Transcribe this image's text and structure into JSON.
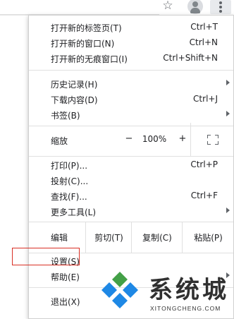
{
  "menu": {
    "group1": [
      {
        "label": "打开新的标签页(T)",
        "shortcut": "Ctrl+T"
      },
      {
        "label": "打开新的窗口(N)",
        "shortcut": "Ctrl+N"
      },
      {
        "label": "打开新的无痕窗口(I)",
        "shortcut": "Ctrl+Shift+N"
      }
    ],
    "group2": [
      {
        "label": "历史记录(H)",
        "shortcut": ""
      },
      {
        "label": "下载内容(D)",
        "shortcut": "Ctrl+J"
      },
      {
        "label": "书签(B)",
        "shortcut": ""
      }
    ],
    "zoom": {
      "label": "缩放",
      "minus": "−",
      "value": "100%",
      "plus": "+"
    },
    "group3": [
      {
        "label": "打印(P)...",
        "shortcut": "Ctrl+P"
      },
      {
        "label": "投射(C)...",
        "shortcut": ""
      },
      {
        "label": "查找(F)...",
        "shortcut": "Ctrl+F"
      },
      {
        "label": "更多工具(L)",
        "shortcut": ""
      }
    ],
    "edit": {
      "label": "编辑",
      "cut": "剪切(T)",
      "copy": "复制(C)",
      "paste": "粘贴(P)"
    },
    "settings": "设置(S)",
    "help": "帮助(E)",
    "exit": "退出(X)"
  },
  "watermark": {
    "title": "系统城",
    "subtitle": "XITONGCHENG.COM"
  },
  "colors": {
    "highlight": "#d93025",
    "logo_blue": "#1e88e5",
    "logo_green": "#43a047"
  },
  "icons": {
    "bookmark": "star-icon",
    "profile": "avatar-icon",
    "menu": "kebab-menu-icon",
    "fullscreen": "fullscreen-icon",
    "submenu": "chevron-right-icon"
  }
}
